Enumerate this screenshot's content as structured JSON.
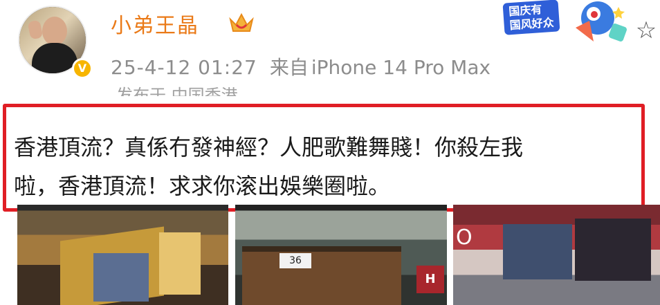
{
  "user": {
    "name": "小弟王晶",
    "verified_badge": "V",
    "crown_icon": "crown-icon"
  },
  "meta": {
    "time": "25-4-12 01:27",
    "source_label": "来自",
    "device": "iPhone 14 Pro Max",
    "location": "发布于 中国香港"
  },
  "festival_badge": {
    "line1": "国庆有",
    "line2": "国风好众"
  },
  "post": {
    "line1": "香港頂流？真係冇發神經？人肥歌難舞賤！你殺左我",
    "line2": "啦，香港頂流！求求你滚出娛樂圈啦。"
  },
  "photos": {
    "tram_sign": "36",
    "shop_sign": "H"
  },
  "colors": {
    "username": "#ea7a18",
    "highlight_border": "#e01e25",
    "meta_text": "#8c8c8c"
  }
}
